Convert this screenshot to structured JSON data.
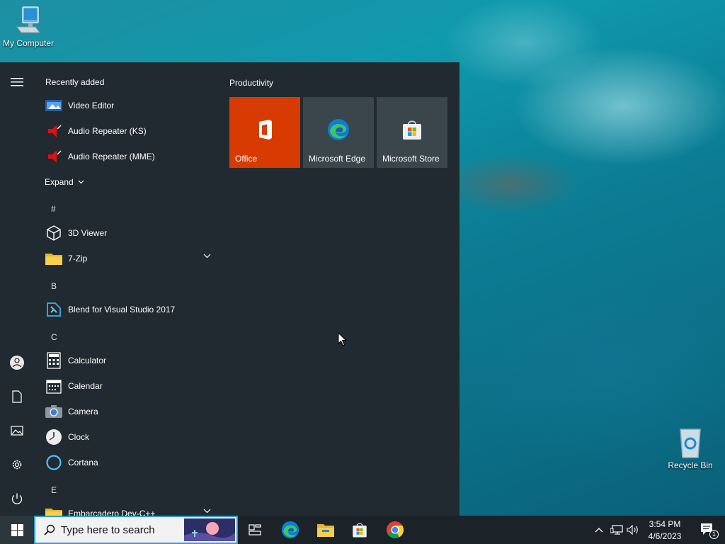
{
  "desktop": {
    "icons": [
      {
        "label": "My Computer"
      },
      {
        "label": "Recycle Bin"
      }
    ]
  },
  "start_menu": {
    "recently_added_header": "Recently added",
    "recent_apps": [
      {
        "label": "Video Editor"
      },
      {
        "label": "Audio Repeater (KS)"
      },
      {
        "label": "Audio Repeater (MME)"
      }
    ],
    "expand_label": "Expand",
    "groups": [
      {
        "letter": "#",
        "apps": [
          {
            "label": "3D Viewer"
          },
          {
            "label": "7-Zip"
          }
        ]
      },
      {
        "letter": "B",
        "apps": [
          {
            "label": "Blend for Visual Studio 2017"
          }
        ]
      },
      {
        "letter": "C",
        "apps": [
          {
            "label": "Calculator"
          },
          {
            "label": "Calendar"
          },
          {
            "label": "Camera"
          },
          {
            "label": "Clock"
          },
          {
            "label": "Cortana"
          }
        ]
      },
      {
        "letter": "E",
        "apps": [
          {
            "label": "Embarcadero Dev-C++"
          }
        ]
      }
    ],
    "tiles_header": "Productivity",
    "tiles": [
      {
        "label": "Office",
        "color": "#d83b01"
      },
      {
        "label": "Microsoft Edge",
        "color": "#3a464c"
      },
      {
        "label": "Microsoft Store",
        "color": "#3a464c"
      }
    ]
  },
  "taskbar": {
    "search_placeholder": "Type here to search",
    "clock_time": "3:54 PM",
    "clock_date": "4/6/2023",
    "notification_count": "1",
    "accent_color": "#2e9fd8"
  }
}
